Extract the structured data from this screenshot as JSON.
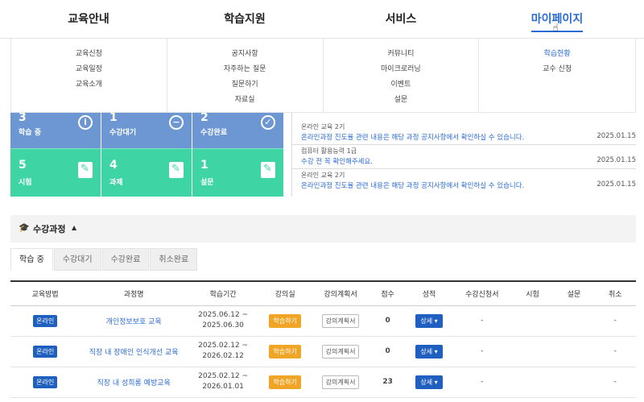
{
  "nav": {
    "items": [
      {
        "label": "교육안내"
      },
      {
        "label": "학습지원"
      },
      {
        "label": "서비스"
      },
      {
        "label": "마이페이지"
      }
    ]
  },
  "menu": {
    "col1": [
      "교육신청",
      "교육일정",
      "교육소개"
    ],
    "col2": [
      "공지사항",
      "자주하는 질문",
      "질문하기",
      "자료실"
    ],
    "col3": [
      "커뮤니티",
      "마이크로러닝",
      "이벤트",
      "설문"
    ],
    "col4": [
      "학습현황",
      "교수 신청"
    ]
  },
  "stats": {
    "learning": {
      "count": "3",
      "label": "학습 중"
    },
    "waiting": {
      "count": "1",
      "label": "수강대기"
    },
    "completed": {
      "count": "2",
      "label": "수강완료"
    },
    "exam": {
      "count": "5",
      "label": "시험"
    },
    "assignment": {
      "count": "4",
      "label": "과제"
    },
    "survey": {
      "count": "1",
      "label": "설문"
    }
  },
  "notices": [
    {
      "category": "온라인 교육 2기",
      "message": "온라인과정 진도율 관련 내용은 해당 과정 공지사항에서 확인하실 수 있습니다.",
      "date": "2025.01.15"
    },
    {
      "category": "컴퓨터 활용능력 1급",
      "message": "수강 전 꼭 확인해주세요.",
      "date": "2025.01.15"
    },
    {
      "category": "온라인 교육 2기",
      "message": "온라인과정 진도율 관련 내용은 해당 과정 공지사항에서 확인하실 수 있습니다.",
      "date": "2025.01.15"
    }
  ],
  "section": {
    "title": "수강과정"
  },
  "tabs": [
    "학습 중",
    "수강대기",
    "수강완료",
    "취소완료"
  ],
  "table": {
    "headers": [
      "교육방법",
      "과정명",
      "학습기간",
      "강의실",
      "강의계획서",
      "점수",
      "성적",
      "수강신청서",
      "시험",
      "설문",
      "취소"
    ],
    "rows": [
      {
        "method": "온라인",
        "course": "개인정보보호 교육",
        "period_start": "2025.06.12 ~",
        "period_end": "2025.06.30",
        "room": "학습하기",
        "plan": "강의계획서",
        "score": "0",
        "grade": "상세 ▾",
        "application": "-",
        "exam": "",
        "survey": "",
        "cancel": "-"
      },
      {
        "method": "온라인",
        "course": "직장 내 장애인 인식개선 교육",
        "period_start": "2025.02.12 ~",
        "period_end": "2026.02.12",
        "room": "학습하기",
        "plan": "강의계획서",
        "score": "0",
        "grade": "상세 ▾",
        "application": "-",
        "exam": "",
        "survey": "",
        "cancel": "-"
      },
      {
        "method": "온라인",
        "course": "직장 내 성희롱 예방교육",
        "period_start": "2025.02.12 ~",
        "period_end": "2026.01.01",
        "room": "학습하기",
        "plan": "강의계획서",
        "score": "23",
        "grade": "상세 ▾",
        "application": "-",
        "exam": "",
        "survey": "",
        "cancel": "-"
      }
    ]
  }
}
